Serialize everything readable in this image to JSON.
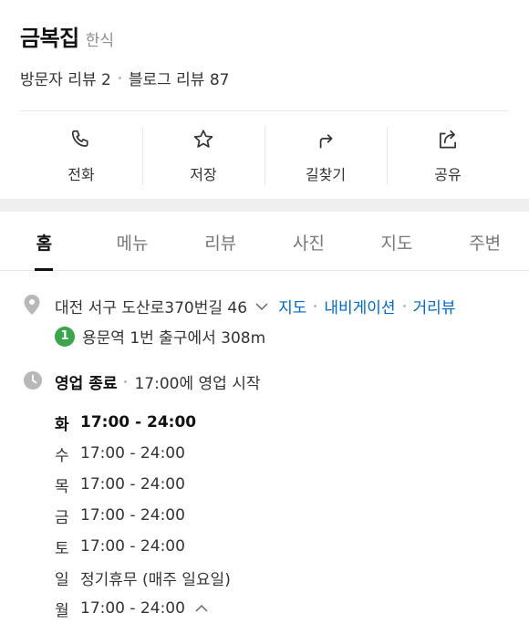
{
  "place": {
    "name": "금복집",
    "category": "한식",
    "visitor_reviews": "방문자 리뷰 2",
    "blog_reviews": "블로그 리뷰 87"
  },
  "actions": [
    {
      "label": "전화",
      "icon": "phone-icon"
    },
    {
      "label": "저장",
      "icon": "star-icon"
    },
    {
      "label": "길찾기",
      "icon": "directions-icon"
    },
    {
      "label": "공유",
      "icon": "share-icon"
    }
  ],
  "tabs": [
    "홈",
    "메뉴",
    "리뷰",
    "사진",
    "지도",
    "주변"
  ],
  "active_tab": "홈",
  "address": {
    "text": "대전 서구 도산로370번길 46",
    "links": [
      "지도",
      "내비게이션",
      "거리뷰"
    ]
  },
  "subway": {
    "line": "1",
    "line_color": "#3aa54a",
    "text": "용문역 1번 출구에서 308m"
  },
  "business": {
    "status": "영업 종료",
    "next": "17:00에 영업 시작",
    "hours": [
      {
        "day": "화",
        "time": "17:00 - 24:00",
        "today": true
      },
      {
        "day": "수",
        "time": "17:00 - 24:00"
      },
      {
        "day": "목",
        "time": "17:00 - 24:00"
      },
      {
        "day": "금",
        "time": "17:00 - 24:00"
      },
      {
        "day": "토",
        "time": "17:00 - 24:00"
      },
      {
        "day": "일",
        "time": "정기휴무 (매주 일요일)"
      },
      {
        "day": "월",
        "time": "17:00 - 24:00"
      }
    ]
  },
  "colors": {
    "link": "#0068c3",
    "accent_text": "#111111"
  }
}
